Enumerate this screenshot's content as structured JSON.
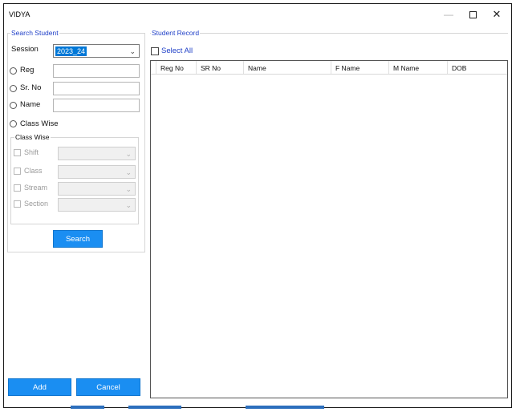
{
  "window": {
    "title": "VIDYA",
    "minimize_glyph": "—",
    "close_glyph": "✕"
  },
  "search_student": {
    "group_title": "Search Student",
    "session_label": "Session",
    "session_value": "2023_24",
    "reg_label": "Reg",
    "srno_label": "Sr. No",
    "name_label": "Name",
    "class_wise_radio_label": "Class Wise",
    "class_wise_group_title": "Class Wise",
    "filters": [
      {
        "label": "Shift"
      },
      {
        "label": "Class"
      },
      {
        "label": "Stream"
      },
      {
        "label": "Section"
      }
    ],
    "search_button": "Search"
  },
  "student_record": {
    "group_title": "Student Record",
    "select_all_label": "Select All",
    "columns": [
      "Reg No",
      "SR No",
      "Name",
      "F Name",
      "M Name",
      "DOB"
    ]
  },
  "footer": {
    "add_button": "Add",
    "cancel_button": "Cancel"
  },
  "icons": {
    "chevron": "chevron-down-icon"
  }
}
